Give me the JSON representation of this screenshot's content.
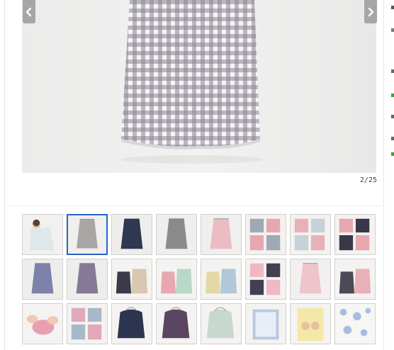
{
  "gallery": {
    "counter": "2/25",
    "current_index": 2,
    "total": 25,
    "prev_icon": "chevron-left-icon",
    "next_icon": "chevron-right-icon",
    "main_image": "gingham-nursing-cover"
  },
  "thumbnails": [
    {
      "kind": "person-cover",
      "bg": "#f2f1ef",
      "color": "#dfe8e9"
    },
    {
      "kind": "cover",
      "bg": "#f0efed",
      "color": "#a8a6a4",
      "active": true
    },
    {
      "kind": "cover",
      "bg": "#eeedeb",
      "color": "#2f3850"
    },
    {
      "kind": "cover",
      "bg": "#efeeec",
      "color": "#8a8a8c"
    },
    {
      "kind": "cover",
      "bg": "#f1efed",
      "color": "#ecbcc4"
    },
    {
      "kind": "bags4",
      "bg": "#f3f2f0",
      "color": "#9fa8b4",
      "color2": "#e6a8b0"
    },
    {
      "kind": "bags4",
      "bg": "#f3f2f0",
      "color": "#e8b0b8",
      "color2": "#c8d0d8"
    },
    {
      "kind": "bags4",
      "bg": "#f3f2f0",
      "color": "#e6a8ae",
      "color2": "#383848"
    },
    {
      "kind": "cover",
      "bg": "#eeedeb",
      "color": "#7c82a8"
    },
    {
      "kind": "cover",
      "bg": "#eeedeb",
      "color": "#847a98"
    },
    {
      "kind": "bags2",
      "bg": "#f4f3f1",
      "color": "#3a3a48",
      "color2": "#d8c8b0"
    },
    {
      "kind": "bags2",
      "bg": "#f4f3f1",
      "color": "#e8a8b0",
      "color2": "#b8d8c8"
    },
    {
      "kind": "bags2",
      "bg": "#f4f3f1",
      "color": "#e4d8a8",
      "color2": "#b0c8d8"
    },
    {
      "kind": "bags4",
      "bg": "#f4f3f1",
      "color": "#f0b8c4",
      "color2": "#404050"
    },
    {
      "kind": "cover",
      "bg": "#f2f0ee",
      "color": "#f0c4cc"
    },
    {
      "kind": "bags2",
      "bg": "#f4f3f1",
      "color": "#4a4a58",
      "color2": "#e8b0b8"
    },
    {
      "kind": "hands",
      "bg": "#f4f3f1",
      "color": "#e8a0b0"
    },
    {
      "kind": "bags4",
      "bg": "#f4f3f1",
      "color": "#e0a8b8",
      "color2": "#a8b8c8"
    },
    {
      "kind": "bag1",
      "bg": "#f4f3f1",
      "color": "#2c3450"
    },
    {
      "kind": "bag1",
      "bg": "#f4f3f1",
      "color": "#5a4660"
    },
    {
      "kind": "bag1",
      "bg": "#f4f3f1",
      "color": "#c8d8d0"
    },
    {
      "kind": "pattern",
      "bg": "#f4f3f1",
      "color": "#b8c8e0"
    },
    {
      "kind": "booklet",
      "bg": "#f4f3f1",
      "color": "#f4e8a8"
    },
    {
      "kind": "dots",
      "bg": "#f6f6f4",
      "color": "#a8bce0"
    }
  ]
}
